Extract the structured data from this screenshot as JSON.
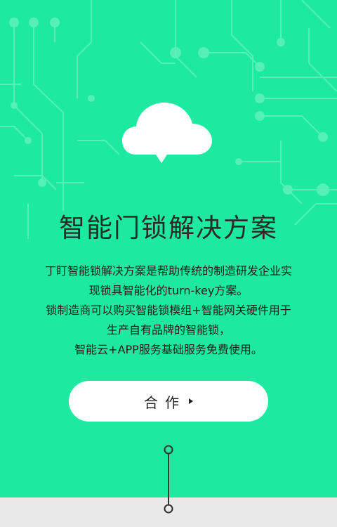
{
  "title": "智能门锁解决方案",
  "description_lines": [
    "丁盯智能锁解决方案是帮助传统的制造研发企业实",
    "现锁具智能化的turn-key方案。",
    "锁制造商可以购买智能锁模组+智能网关硬件用于",
    "生产自有品牌的智能锁，",
    "智能云+APP服务基础服务免费使用。"
  ],
  "cta_label": "合作",
  "icons": {
    "hero": "cloud-icon",
    "cta": "play-arrow-icon"
  },
  "colors": {
    "background": "#1de9a0",
    "circuit": "#5cf0bc",
    "button": "#ffffff",
    "text": "#222222",
    "bottom_band": "#e9e9e9"
  }
}
